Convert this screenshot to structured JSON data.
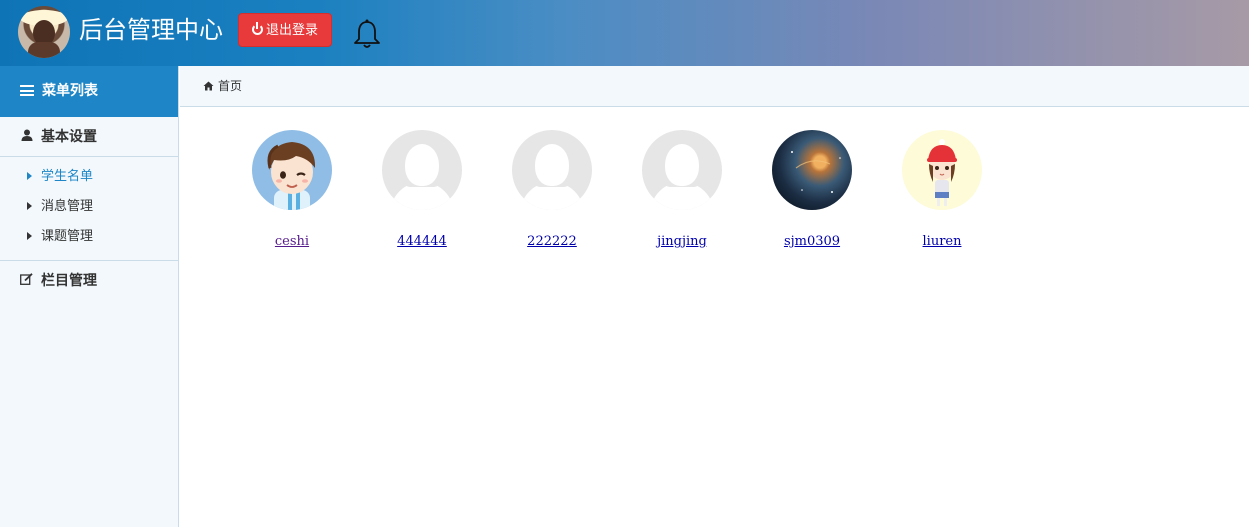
{
  "header": {
    "title": "后台管理中心",
    "logout_label": "退出登录",
    "bell_icon": "bell-icon"
  },
  "sidebar": {
    "heading": "菜单列表",
    "groups": [
      {
        "label": "基本设置",
        "icon": "user-icon",
        "items": [
          {
            "label": "学生名单",
            "active": true
          },
          {
            "label": "消息管理",
            "active": false
          },
          {
            "label": "课题管理",
            "active": false
          }
        ]
      },
      {
        "label": "栏目管理",
        "icon": "edit-icon",
        "items": []
      }
    ]
  },
  "breadcrumb": {
    "home": "首页"
  },
  "users": [
    {
      "name": "ceshi",
      "avatar": "cartoon-boy"
    },
    {
      "name": "444444",
      "avatar": "default"
    },
    {
      "name": "222222",
      "avatar": "default"
    },
    {
      "name": "jingjing",
      "avatar": "default"
    },
    {
      "name": "sjm0309",
      "avatar": "galaxy"
    },
    {
      "name": "liuren",
      "avatar": "cartoon-girl"
    }
  ],
  "colors": {
    "header_start": "#0f74b6",
    "header_end": "#a79aa6",
    "logout": "#e83a3a",
    "accent": "#1e86c6",
    "sidebar_bg": "#f2f8fc"
  }
}
